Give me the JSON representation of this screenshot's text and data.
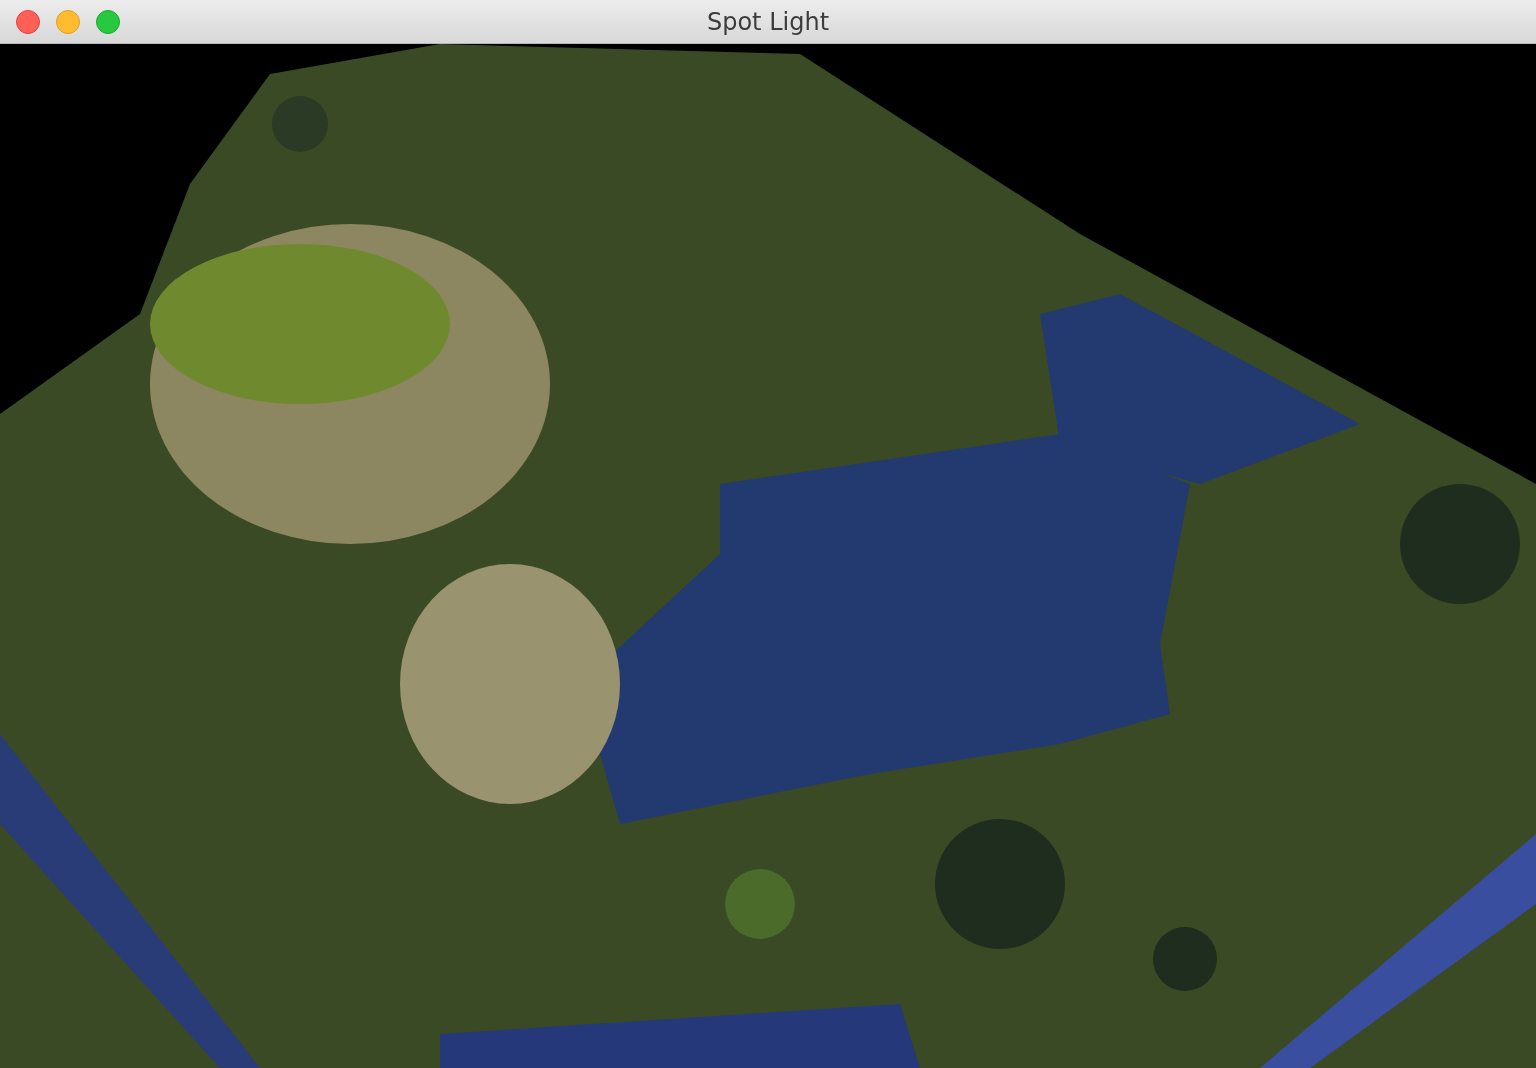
{
  "window": {
    "title": "Spot Light"
  }
}
